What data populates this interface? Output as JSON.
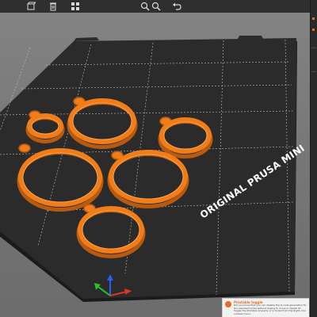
{
  "app": {
    "accent_color": "#ed6b21",
    "part_color": "#f07d1a",
    "bed_color": "#2b2b2b"
  },
  "toolbar": {
    "buttons": [
      {
        "name": "add-object-icon"
      },
      {
        "name": "delete-icon"
      },
      {
        "name": "arrange-icon"
      },
      {
        "name": "zoom-icon"
      },
      {
        "name": "undo-icon"
      }
    ]
  },
  "bed": {
    "label": "ORIGINAL PRUSA MINI"
  },
  "parts": [
    {
      "name": "ring-small"
    },
    {
      "name": "ring-top-middle"
    },
    {
      "name": "ring-right-small"
    },
    {
      "name": "ring-large-left"
    },
    {
      "name": "ring-large-center"
    },
    {
      "name": "ring-bottom"
    }
  ],
  "axes": {
    "x_color": "#e0322b",
    "y_color": "#2bbf2b",
    "z_color": "#2a5cff"
  },
  "hint": {
    "title": "Printable toggle",
    "text": "Did you know that you can disable the G-code generation for the selected model without having to move or delete it? Toggle the Printable property of a model from the Right-click context menu."
  }
}
